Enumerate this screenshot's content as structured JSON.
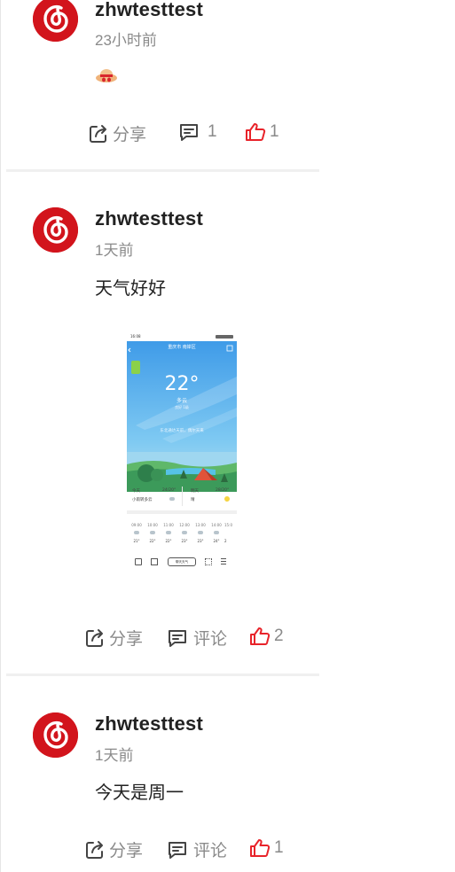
{
  "colors": {
    "brand_red": "#d2141c",
    "like_red": "#e8232a",
    "text_gray": "#8a8a8a"
  },
  "posts": [
    {
      "username": "zhwtesttest",
      "time": "23小时前",
      "content_emoji": "hat-emoji",
      "actions": {
        "share_label": "分享",
        "comment_label": "1",
        "like_count": "1"
      }
    },
    {
      "username": "zhwtesttest",
      "time": "1天前",
      "content": "天气好好",
      "image": {
        "statusbar_time": "16:08",
        "city": "重庆市 南岸区",
        "temperature": "22°",
        "condition": "多云",
        "air": "良好 1级",
        "hint": "东北通达天前，偶尔天来",
        "forecast": [
          {
            "day": "今天",
            "range": "24/20°",
            "text": "小雨转多云"
          },
          {
            "day": "明天",
            "range": "28/20°",
            "text": "晴"
          }
        ],
        "hourly_times": [
          "09:00",
          "10:00",
          "11:00",
          "12:00",
          "13:00",
          "14:00",
          "15:0"
        ],
        "hourly_temps": [
          "21°",
          "22°",
          "22°",
          "23°",
          "23°",
          "24°",
          "2"
        ],
        "nav_center": "聊天天气"
      },
      "actions": {
        "share_label": "分享",
        "comment_label": "评论",
        "like_count": "2"
      }
    },
    {
      "username": "zhwtesttest",
      "time": "1天前",
      "content": "今天是周一",
      "actions": {
        "share_label": "分享",
        "comment_label": "评论",
        "like_count": "1"
      }
    }
  ]
}
